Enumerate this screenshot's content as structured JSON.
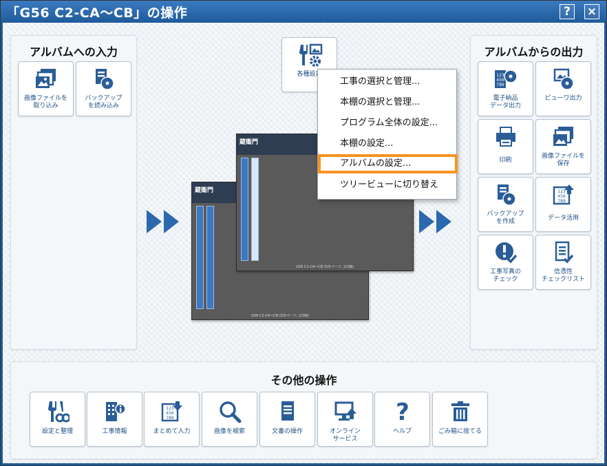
{
  "window": {
    "title": "「G56 C2-CA～CB」の操作",
    "help_label": "?",
    "close_label": "×"
  },
  "left_panel": {
    "title": "アルバムへの入力",
    "tiles": [
      {
        "label": "画像ファイルを\n取り込み",
        "icon": "image-import-icon"
      },
      {
        "label": "バックアップ\nを読み込み",
        "icon": "backup-restore-icon"
      }
    ]
  },
  "right_panel": {
    "title": "アルバムからの出力",
    "tiles": [
      {
        "label": "電子納品\nデータ出力",
        "icon": "electronic-delivery-icon"
      },
      {
        "label": "ビューワ出力",
        "icon": "viewer-output-icon"
      },
      {
        "label": "印刷",
        "icon": "printer-icon"
      },
      {
        "label": "画像ファイルを\n保存",
        "icon": "image-save-icon"
      },
      {
        "label": "バックアップ\nを作成",
        "icon": "backup-create-icon"
      },
      {
        "label": "データ活用",
        "icon": "data-use-icon"
      },
      {
        "label": "工事写真の\nチェック",
        "icon": "photo-check-icon"
      },
      {
        "label": "信憑性\nチェックリスト",
        "icon": "checklist-icon"
      }
    ]
  },
  "settings_tile": {
    "label": "各種設定",
    "icon": "settings-icon"
  },
  "context_menu": {
    "items": [
      "工事の選択と管理...",
      "本棚の選択と管理...",
      "プログラム全体の設定...",
      "本棚の設定...",
      "アルバムの設定...",
      "ツリービューに切り替え"
    ],
    "highlighted_index": 4
  },
  "preview": {
    "back": {
      "logo": "蔵衛門",
      "caption": "G56 C2-CA～CB (5/5ページ, 2/2冊)"
    },
    "front": {
      "logo": "蔵衛門",
      "caption": "G56 C2-CA～CB (5/5ページ, 2/2冊)"
    }
  },
  "bottom_panel": {
    "title": "その他の操作",
    "tiles": [
      {
        "label": "設定と整理",
        "icon": "tools-icon"
      },
      {
        "label": "工事情報",
        "icon": "construction-info-icon"
      },
      {
        "label": "まとめて入力",
        "icon": "bulk-input-icon"
      },
      {
        "label": "画像を検索",
        "icon": "search-icon"
      },
      {
        "label": "文書の操作",
        "icon": "document-icon"
      },
      {
        "label": "オンライン\nサービス",
        "icon": "online-service-icon"
      },
      {
        "label": "ヘルプ",
        "icon": "help-icon"
      },
      {
        "label": "ごみ箱に捨てる",
        "icon": "trash-icon"
      }
    ]
  },
  "colors": {
    "title_bar": "#1f5a9a",
    "accent": "#2c68ad",
    "highlight": "#f7931e",
    "icon": "#2a5d97"
  }
}
